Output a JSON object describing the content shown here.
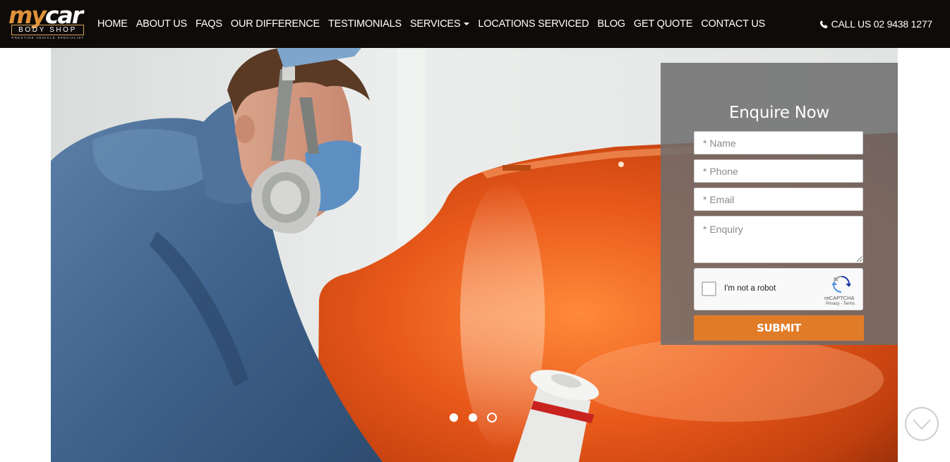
{
  "brand": {
    "logo_my": "my",
    "logo_car": "car",
    "logo_sub": "BODY SHOP",
    "logo_tagline": "PRESTIGE VEHICLE SPECIALIST",
    "colors": {
      "accent": "#e0923a",
      "nav_bg": "#0f0b08",
      "submit": "#e07c28"
    }
  },
  "nav": {
    "items": [
      {
        "label": "HOME"
      },
      {
        "label": "ABOUT US"
      },
      {
        "label": "FAQS"
      },
      {
        "label": "OUR DIFFERENCE"
      },
      {
        "label": "TESTIMONIALS"
      },
      {
        "label": "SERVICES",
        "dropdown": true
      },
      {
        "label": "LOCATIONS SERVICED"
      },
      {
        "label": "BLOG"
      },
      {
        "label": "GET QUOTE"
      },
      {
        "label": "CONTACT US"
      }
    ],
    "call": {
      "icon": "phone-icon",
      "label": "CALL US 02 9438 1277"
    }
  },
  "hero": {
    "image": "spray-painter-with-respirator-and-orange-car-panel",
    "slides": {
      "count": 3,
      "active": 3
    }
  },
  "enquiry": {
    "title": "Enquire Now",
    "name_placeholder": "* Name",
    "phone_placeholder": "* Phone",
    "email_placeholder": "* Email",
    "enquiry_placeholder": "* Enquiry",
    "captcha": {
      "label": "I'm not a robot",
      "brand": "reCAPTCHA",
      "links": "Privacy - Terms",
      "icon": "recaptcha-icon"
    },
    "submit_label": "SUBMIT"
  },
  "scroll": {
    "icon": "chevron-down-circle-icon"
  }
}
